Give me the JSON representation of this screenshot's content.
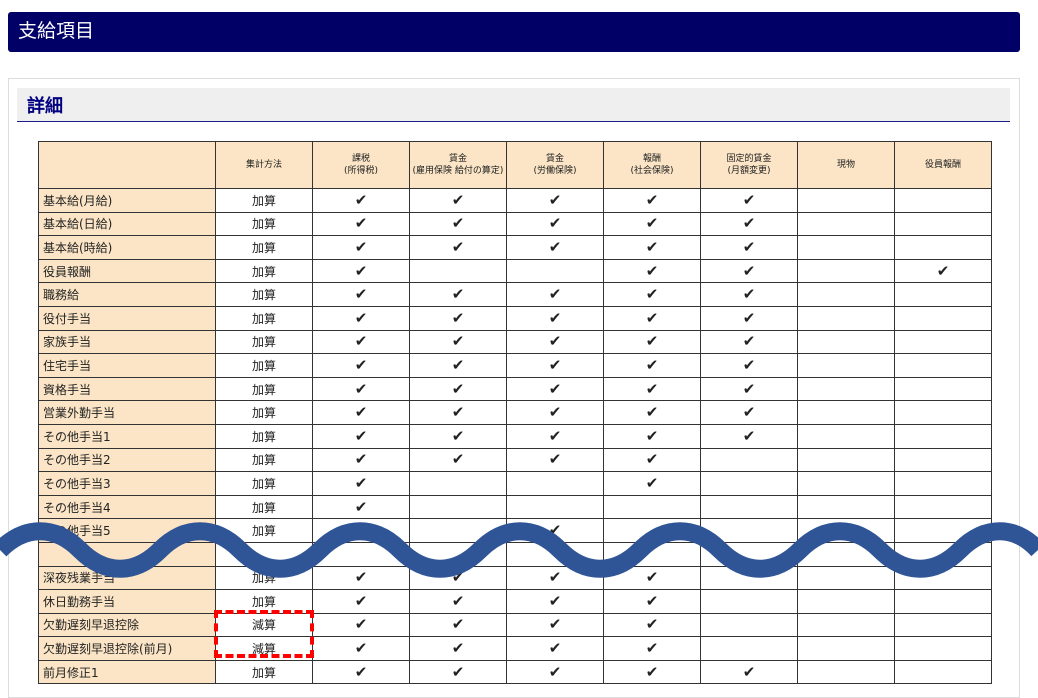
{
  "page": {
    "title": "支給項目"
  },
  "section": {
    "title": "詳細"
  },
  "table": {
    "headers": [
      "",
      "集計方法",
      "課税\n(所得税)",
      "賃金\n(雇用保険 給付の算定)",
      "賃金\n(労働保険)",
      "報酬\n(社会保険)",
      "固定的賃金\n(月額変更)",
      "現物",
      "役員報酬"
    ],
    "check_symbol": "✔",
    "rows": [
      {
        "label": "基本給(月給)",
        "method": "加算",
        "checks": [
          1,
          1,
          1,
          1,
          1,
          0,
          0
        ]
      },
      {
        "label": "基本給(日給)",
        "method": "加算",
        "checks": [
          1,
          1,
          1,
          1,
          1,
          0,
          0
        ]
      },
      {
        "label": "基本給(時給)",
        "method": "加算",
        "checks": [
          1,
          1,
          1,
          1,
          1,
          0,
          0
        ]
      },
      {
        "label": "役員報酬",
        "method": "加算",
        "checks": [
          1,
          0,
          0,
          1,
          1,
          0,
          1
        ]
      },
      {
        "label": "職務給",
        "method": "加算",
        "checks": [
          1,
          1,
          1,
          1,
          1,
          0,
          0
        ]
      },
      {
        "label": "役付手当",
        "method": "加算",
        "checks": [
          1,
          1,
          1,
          1,
          1,
          0,
          0
        ]
      },
      {
        "label": "家族手当",
        "method": "加算",
        "checks": [
          1,
          1,
          1,
          1,
          1,
          0,
          0
        ]
      },
      {
        "label": "住宅手当",
        "method": "加算",
        "checks": [
          1,
          1,
          1,
          1,
          1,
          0,
          0
        ]
      },
      {
        "label": "資格手当",
        "method": "加算",
        "checks": [
          1,
          1,
          1,
          1,
          1,
          0,
          0
        ]
      },
      {
        "label": "営業外勤手当",
        "method": "加算",
        "checks": [
          1,
          1,
          1,
          1,
          1,
          0,
          0
        ]
      },
      {
        "label": "その他手当1",
        "method": "加算",
        "checks": [
          1,
          1,
          1,
          1,
          1,
          0,
          0
        ]
      },
      {
        "label": "その他手当2",
        "method": "加算",
        "checks": [
          1,
          1,
          1,
          1,
          0,
          0,
          0
        ]
      },
      {
        "label": "その他手当3",
        "method": "加算",
        "checks": [
          1,
          0,
          0,
          1,
          0,
          0,
          0
        ]
      },
      {
        "label": "その他手当4",
        "method": "加算",
        "checks": [
          1,
          0,
          0,
          0,
          0,
          0,
          0
        ]
      },
      {
        "label": "その他手当5",
        "method": "加算",
        "checks": [
          1,
          0,
          1,
          0,
          0,
          0,
          0
        ]
      },
      {
        "label": "",
        "method": "",
        "checks": [
          0,
          0,
          0,
          0,
          0,
          0,
          0
        ]
      },
      {
        "label": "深夜残業手当",
        "method": "加算",
        "checks": [
          1,
          1,
          1,
          1,
          0,
          0,
          0
        ]
      },
      {
        "label": "休日勤務手当",
        "method": "加算",
        "checks": [
          1,
          1,
          1,
          1,
          0,
          0,
          0
        ]
      },
      {
        "label": "欠勤遅刻早退控除",
        "method": "減算",
        "checks": [
          1,
          1,
          1,
          1,
          0,
          0,
          0
        ]
      },
      {
        "label": "欠勤遅刻早退控除(前月)",
        "method": "減算",
        "checks": [
          1,
          1,
          1,
          1,
          0,
          0,
          0
        ]
      },
      {
        "label": "前月修正1",
        "method": "加算",
        "checks": [
          1,
          1,
          1,
          1,
          1,
          0,
          0
        ]
      }
    ]
  },
  "colors": {
    "title_bar": "#000066",
    "header_fill": "#fbe5c6",
    "wave": "#2f5597",
    "highlight_box": "#ff0000"
  }
}
